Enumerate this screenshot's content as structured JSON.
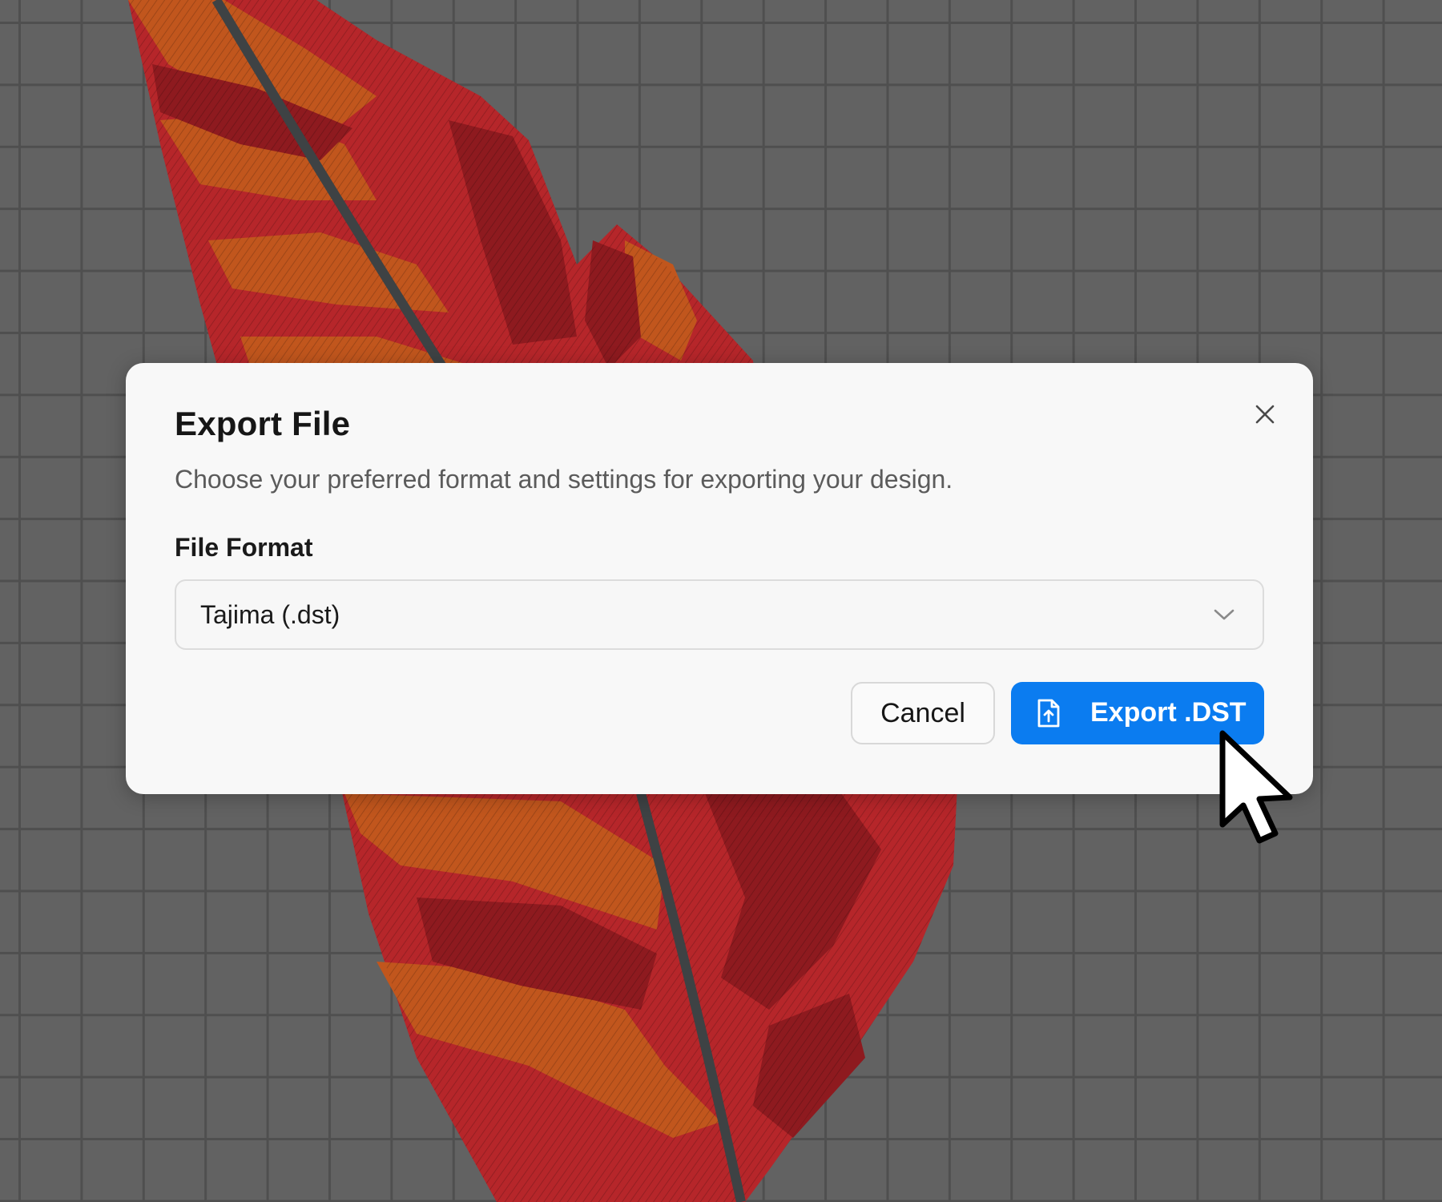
{
  "dialog": {
    "title": "Export File",
    "description": "Choose your preferred format and settings for exporting your design.",
    "close_icon": "close-icon"
  },
  "format_field": {
    "label": "File Format",
    "selected_value": "Tajima (.dst)",
    "chevron_icon": "chevron-down-icon"
  },
  "actions": {
    "cancel_label": "Cancel",
    "export_label": "Export .DST",
    "export_icon": "file-upload-icon"
  },
  "colors": {
    "primary": "#0b7cf0",
    "canvas_bg": "#626262",
    "dialog_bg": "#f8f8f8"
  }
}
